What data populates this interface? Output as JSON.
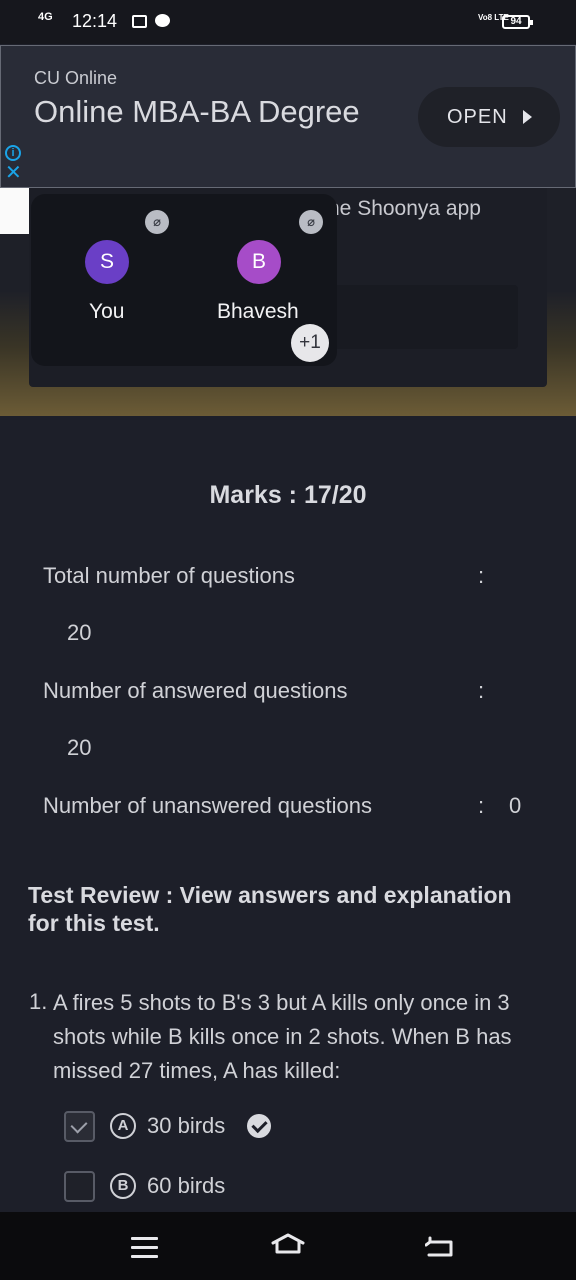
{
  "status_bar": {
    "network": "4G",
    "time": "12:14",
    "volte": "Vo8 LTE",
    "battery": "94"
  },
  "ad": {
    "sponsor": "CU Online",
    "title": "Online MBA-BA Degree",
    "button_label": "OPEN",
    "info_icon": "info-icon",
    "close_icon": "close-icon"
  },
  "meeting": {
    "background_text": "ne Shoonya app",
    "participants": [
      {
        "initial": "S",
        "name": "You",
        "color": "#6a3fc6",
        "muted": true
      },
      {
        "initial": "B",
        "name": "Bhavesh",
        "color": "#a64cc8",
        "muted": true
      }
    ],
    "more_count": "+1"
  },
  "results": {
    "marks": "Marks : 17/20",
    "total_label": "Total number of questions",
    "total_value": "20",
    "answered_label": "Number of answered questions",
    "answered_value": "20",
    "unanswered_label": "Number of unanswered questions",
    "unanswered_value": "0",
    "colon": ":"
  },
  "review": {
    "heading": "Test Review : View answers and explanation for this test.",
    "question_number": "1.",
    "question_text": "A fires 5 shots to B's 3 but A kills only once in 3 shots while B kills once in 2 shots. When B has missed 27 times, A has killed:",
    "options": [
      {
        "letter": "A",
        "text": "30 birds",
        "checked": true,
        "correct": true
      },
      {
        "letter": "B",
        "text": "60 birds",
        "checked": false,
        "correct": false
      }
    ]
  },
  "nav": {
    "menu_icon": "menu-icon",
    "home_icon": "home-icon",
    "back_icon": "back-icon"
  }
}
